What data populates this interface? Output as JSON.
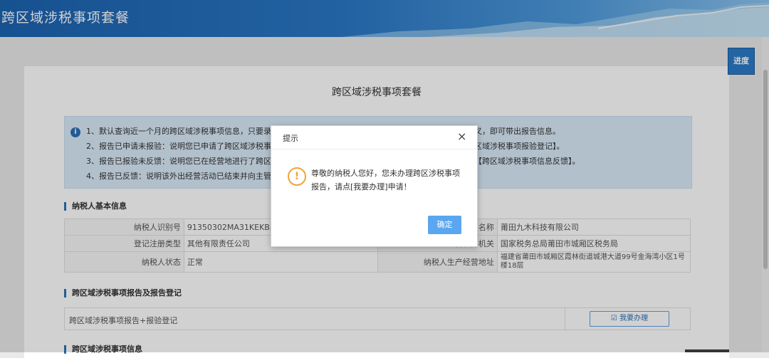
{
  "header": {
    "title": "跨区域涉税事项套餐"
  },
  "progress_button": "进度",
  "page": {
    "title": "跨区域涉税事项套餐"
  },
  "notice": {
    "lines": [
      "1、默认查询近一个月的跨区域涉税事项信息，只要录",
      "2、报告已申请未报验：说明您已申请了跨区域涉税事项",
      "3、报告已报验未反馈：说明您已在经营地进行了跨区",
      "4、报告已反馈：说明该外出经营活动已结束并向主管"
    ],
    "lines_right": [
      "交叉，即可带出报告信息。",
      "跨区域涉税事项报验登记】。",
      "告【跨区域涉税事项信息反馈】。",
      ""
    ]
  },
  "taxpayer_section": {
    "title": "纳税人基本信息",
    "rows": [
      {
        "l1": "纳税人识别号",
        "v1": "91350302MA31KEKB89",
        "l2": "人名称",
        "v2": "莆田九木科技有限公司"
      },
      {
        "l1": "登记注册类型",
        "v1": "其他有限责任公司",
        "l2": "主管税务机关",
        "v2": "国家税务总局莆田市城厢区税务局"
      },
      {
        "l1": "纳税人状态",
        "v1": "正常",
        "l2": "纳税人生产经营地址",
        "v2": "福建省莆田市城厢区霞林街道城港大道99号金海湾小区1号楼18层"
      }
    ]
  },
  "report_section": {
    "title": "跨区域涉税事项报告及报告登记",
    "row_text": "跨区域涉税事项报告+报验登记",
    "apply_button": "☑ 我要办理"
  },
  "info_section": {
    "title": "跨区域涉税事项信息"
  },
  "dialog": {
    "title": "提示",
    "close": "×",
    "message": "尊敬的纳税人您好，您未办理跨区涉税事项报告，请点[我要办理]申请！",
    "confirm": "确定"
  },
  "colors": {
    "header": "#2b78c6",
    "accent": "#2d6fb8",
    "confirm": "#5aa6f0",
    "warning": "#f0a33a"
  }
}
